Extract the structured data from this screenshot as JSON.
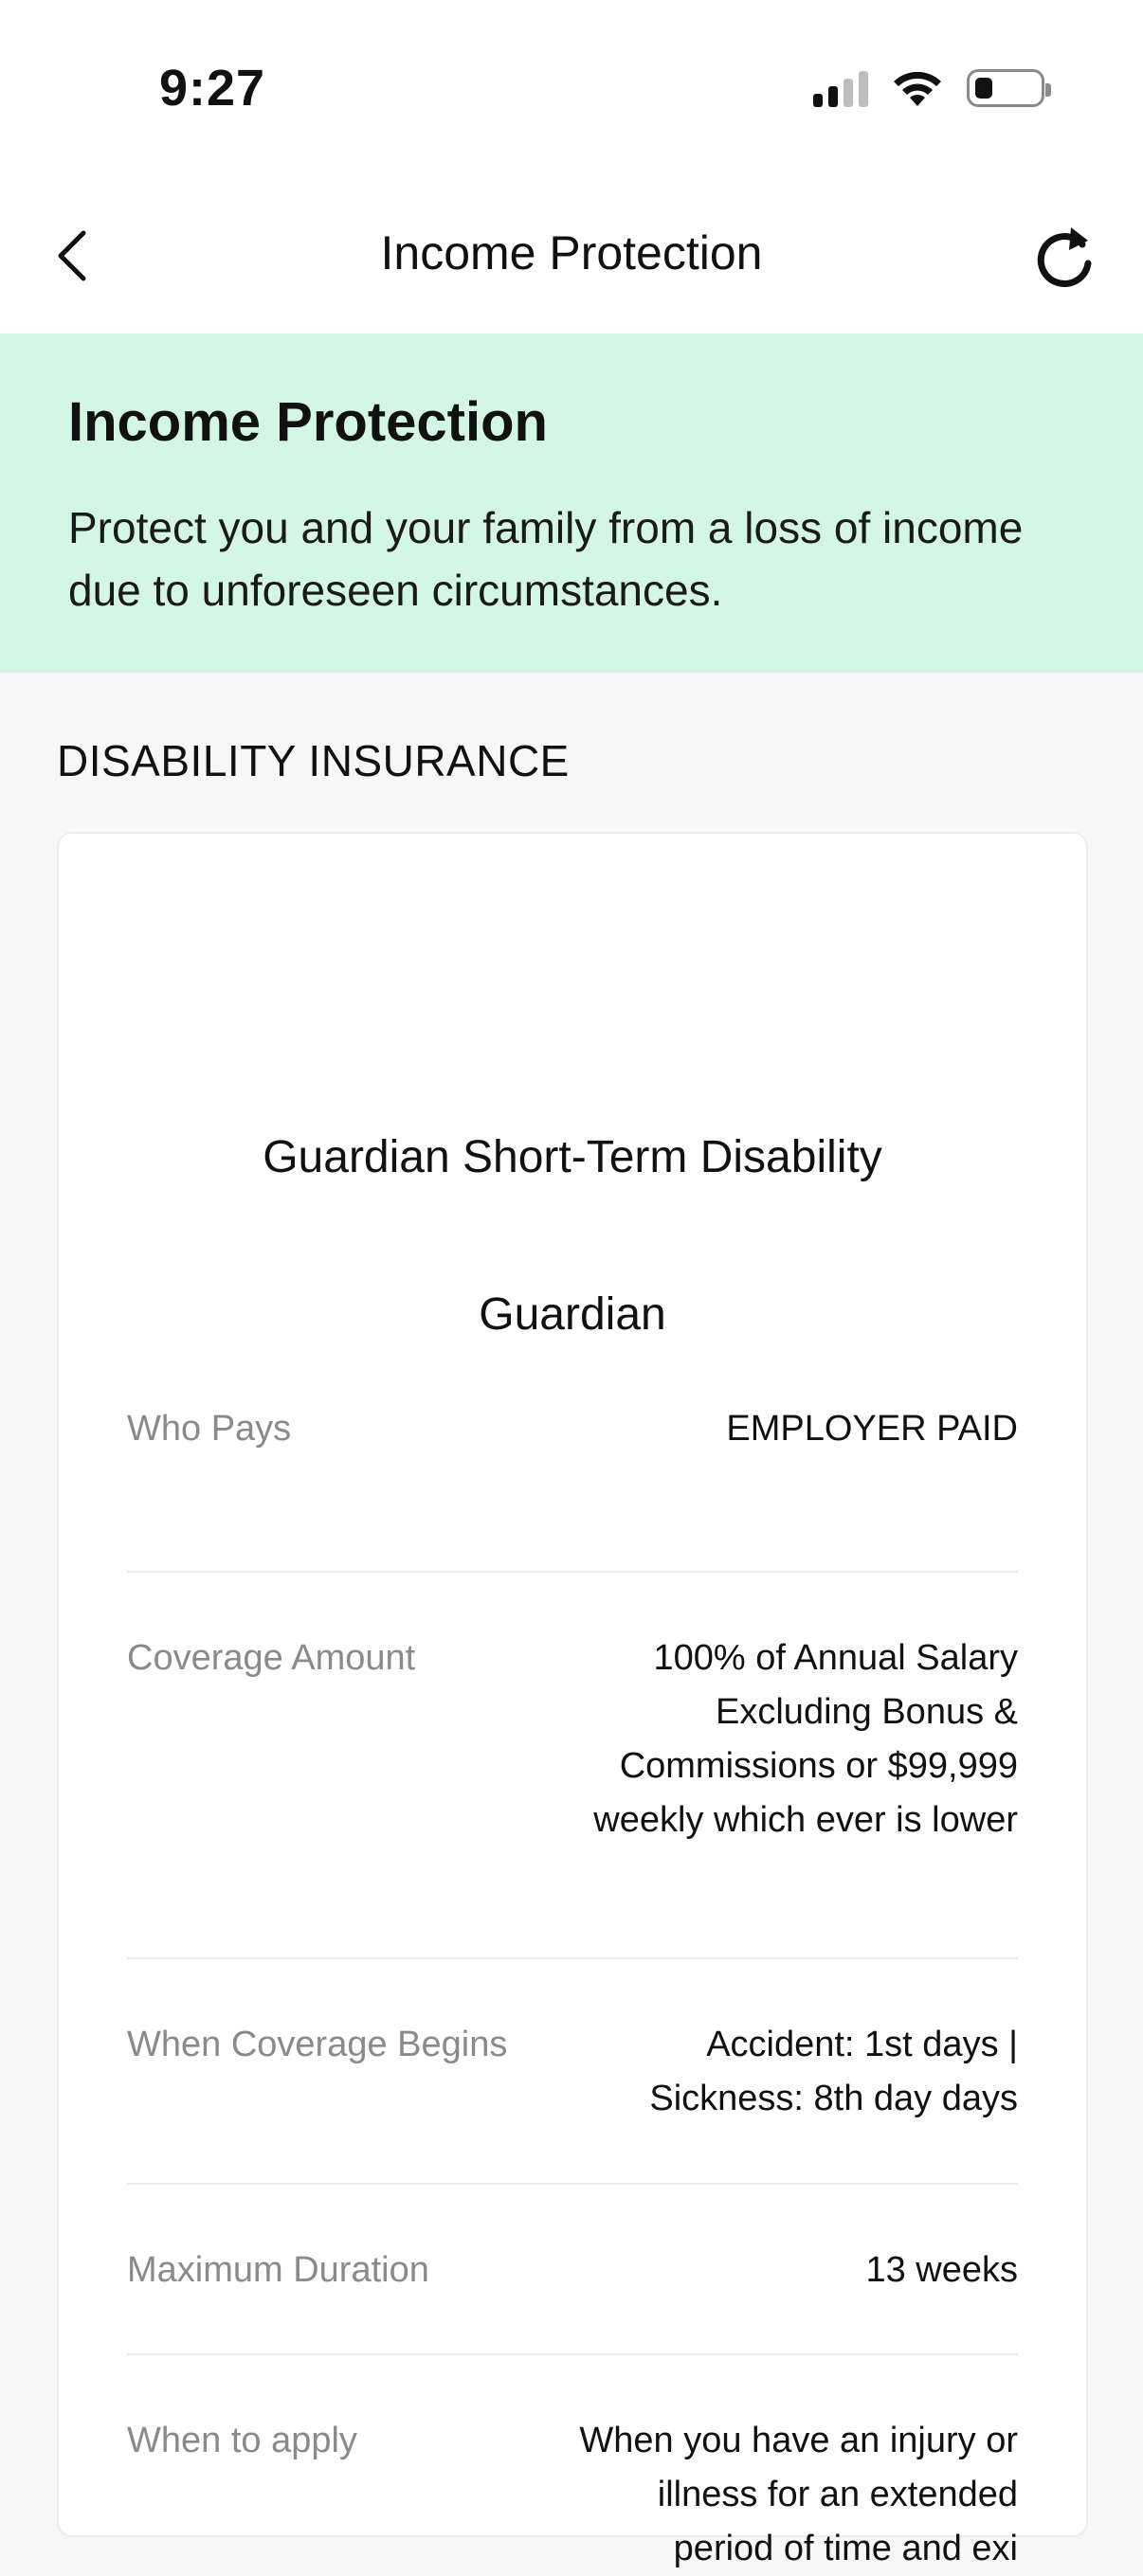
{
  "status_bar": {
    "time": "9:27"
  },
  "nav": {
    "title": "Income Protection"
  },
  "hero": {
    "title": "Income Protection",
    "description": "Protect you and your family from a loss of income due to unforeseen circumstances."
  },
  "section": {
    "header": "DISABILITY INSURANCE"
  },
  "plan": {
    "name": "Guardian Short-Term Disability",
    "carrier": "Guardian",
    "details": [
      {
        "label": "Who Pays",
        "value": "EMPLOYER PAID"
      },
      {
        "label": "Coverage Amount",
        "value": "100% of Annual Salary Excluding Bonus & Commissions or $99,999 weekly which ever is lower"
      },
      {
        "label": "When Coverage Begins",
        "value": "Accident: 1st days | Sickness: 8th day days"
      },
      {
        "label": "Maximum Duration",
        "value": "13 weeks"
      },
      {
        "label": "When to apply",
        "value": "When you have an injury or illness for an extended period of time and exi"
      }
    ]
  }
}
